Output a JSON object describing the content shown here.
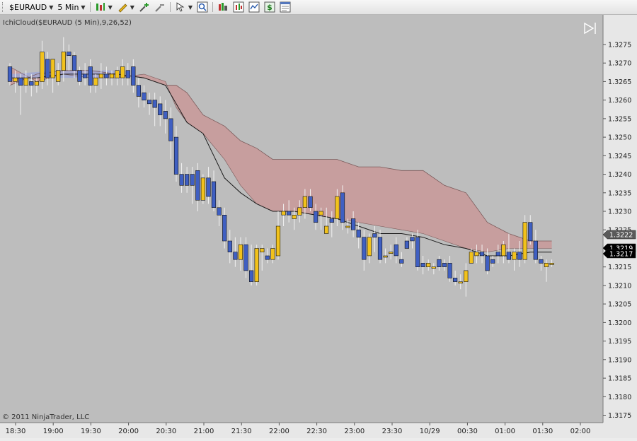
{
  "toolbar": {
    "instrument": "$EURAUD",
    "interval": "5 Min",
    "icons": [
      "bar-style-icon",
      "drawing-tools-icon",
      "zoom-in-icon",
      "zoom-out-icon",
      "cursor-icon",
      "zoom-box-icon",
      "data-box-icon",
      "strategy-icon",
      "chart-trader-icon",
      "dollar-icon",
      "properties-icon"
    ]
  },
  "indicator_label": "IchiCloud($EURAUD (5 Min),9,26,52)",
  "copyright": "© 2011 NinjaTrader, LLC",
  "colors": {
    "background": "#bdbdbd",
    "up_candle": "#f2c21c",
    "down_candle": "#3f5fc2",
    "cloud_bear": "#c89a9a",
    "cloud_bull": "#9fa8d6",
    "kijun_line": "#1a1a1a",
    "price_box_dark": "#000000",
    "price_box_gray": "#5a5a5a"
  },
  "chart_data": {
    "type": "candlestick",
    "y_axis": {
      "min": 1.3173,
      "max": 1.3283,
      "ticks": [
        "1.3175",
        "1.3180",
        "1.3185",
        "1.3190",
        "1.3195",
        "1.3200",
        "1.3205",
        "1.3210",
        "1.3215",
        "1.3220",
        "1.3225",
        "1.3230",
        "1.3235",
        "1.3240",
        "1.3245",
        "1.3250",
        "1.3255",
        "1.3260",
        "1.3265",
        "1.3270",
        "1.3275"
      ]
    },
    "x_axis": {
      "labels": [
        "18:30",
        "19:00",
        "19:30",
        "20:00",
        "20:30",
        "21:00",
        "21:30",
        "22:00",
        "22:30",
        "23:00",
        "23:30",
        "10/29",
        "00:30",
        "01:00",
        "01:30",
        "02:00"
      ]
    },
    "price_markers": [
      {
        "value": "1.3222",
        "style": "gray"
      },
      {
        "value": "1.3219",
        "style": "dark"
      },
      {
        "value": "1.3217",
        "style": "dark"
      }
    ],
    "candles": [
      [
        1.3269,
        1.327,
        1.3264,
        1.3265
      ],
      [
        1.3265,
        1.3268,
        1.3262,
        1.3266
      ],
      [
        1.3266,
        1.3267,
        1.3256,
        1.3264
      ],
      [
        1.3264,
        1.3268,
        1.3262,
        1.3266
      ],
      [
        1.3265,
        1.3267,
        1.3261,
        1.3264
      ],
      [
        1.3264,
        1.3266,
        1.3262,
        1.3265
      ],
      [
        1.3265,
        1.3276,
        1.3263,
        1.3273
      ],
      [
        1.3271,
        1.3273,
        1.3264,
        1.3266
      ],
      [
        1.3266,
        1.3271,
        1.3262,
        1.3271
      ],
      [
        1.3265,
        1.327,
        1.3264,
        1.3268
      ],
      [
        1.3268,
        1.3277,
        1.3265,
        1.3273
      ],
      [
        1.3273,
        1.3275,
        1.3268,
        1.3272
      ],
      [
        1.3272,
        1.3273,
        1.3266,
        1.3268
      ],
      [
        1.3268,
        1.3269,
        1.3264,
        1.3265
      ],
      [
        1.3267,
        1.327,
        1.3264,
        1.3266
      ],
      [
        1.3269,
        1.3271,
        1.3262,
        1.3264
      ],
      [
        1.3264,
        1.3267,
        1.3262,
        1.3266
      ],
      [
        1.3266,
        1.327,
        1.3263,
        1.3267
      ],
      [
        1.3267,
        1.3269,
        1.3264,
        1.3266
      ],
      [
        1.3266,
        1.3268,
        1.3264,
        1.3267
      ],
      [
        1.3266,
        1.3269,
        1.3264,
        1.3268
      ],
      [
        1.3266,
        1.3271,
        1.3264,
        1.3269
      ],
      [
        1.3268,
        1.327,
        1.3264,
        1.3266
      ],
      [
        1.3269,
        1.3271,
        1.3262,
        1.3264
      ],
      [
        1.3264,
        1.3266,
        1.3258,
        1.3261
      ],
      [
        1.3262,
        1.3264,
        1.3258,
        1.326
      ],
      [
        1.326,
        1.3262,
        1.3256,
        1.3259
      ],
      [
        1.326,
        1.3262,
        1.3253,
        1.3258
      ],
      [
        1.3259,
        1.3261,
        1.3253,
        1.3256
      ],
      [
        1.3257,
        1.326,
        1.3251,
        1.3255
      ],
      [
        1.3255,
        1.3258,
        1.3244,
        1.3249
      ],
      [
        1.325,
        1.3253,
        1.3238,
        1.324
      ],
      [
        1.324,
        1.3243,
        1.3235,
        1.3237
      ],
      [
        1.324,
        1.3242,
        1.3235,
        1.3237
      ],
      [
        1.324,
        1.3242,
        1.3232,
        1.3237
      ],
      [
        1.3241,
        1.3243,
        1.323,
        1.3233
      ],
      [
        1.3233,
        1.324,
        1.3232,
        1.3239
      ],
      [
        1.3239,
        1.3242,
        1.3232,
        1.3234
      ],
      [
        1.3238,
        1.3241,
        1.323,
        1.3231
      ],
      [
        1.3231,
        1.3233,
        1.3226,
        1.3229
      ],
      [
        1.3229,
        1.3231,
        1.322,
        1.3222
      ],
      [
        1.3222,
        1.3225,
        1.3216,
        1.3219
      ],
      [
        1.3219,
        1.3223,
        1.3215,
        1.3217
      ],
      [
        1.3217,
        1.3223,
        1.3214,
        1.3221
      ],
      [
        1.3221,
        1.3223,
        1.3212,
        1.3214
      ],
      [
        1.3214,
        1.3221,
        1.321,
        1.3211
      ],
      [
        1.3211,
        1.3221,
        1.321,
        1.322
      ],
      [
        1.3219,
        1.3221,
        1.3214,
        1.322
      ],
      [
        1.3218,
        1.322,
        1.3216,
        1.3217
      ],
      [
        1.3217,
        1.3221,
        1.3216,
        1.322
      ],
      [
        1.3218,
        1.323,
        1.3217,
        1.3226
      ],
      [
        1.3229,
        1.3232,
        1.3226,
        1.323
      ],
      [
        1.323,
        1.3233,
        1.3227,
        1.3229
      ],
      [
        1.3228,
        1.3231,
        1.3225,
        1.3229
      ],
      [
        1.3229,
        1.3233,
        1.3227,
        1.3231
      ],
      [
        1.3231,
        1.3236,
        1.3228,
        1.3234
      ],
      [
        1.3234,
        1.3236,
        1.323,
        1.3231
      ],
      [
        1.323,
        1.3232,
        1.3225,
        1.3227
      ],
      [
        1.3229,
        1.3231,
        1.3225,
        1.323
      ],
      [
        1.3224,
        1.3231,
        1.3224,
        1.3226
      ],
      [
        1.3228,
        1.323,
        1.3223,
        1.3227
      ],
      [
        1.3228,
        1.3236,
        1.3226,
        1.3234
      ],
      [
        1.3235,
        1.3237,
        1.3225,
        1.3227
      ],
      [
        1.3226,
        1.3228,
        1.3224,
        1.3226
      ],
      [
        1.3228,
        1.323,
        1.3223,
        1.3225
      ],
      [
        1.3225,
        1.3227,
        1.322,
        1.3223
      ],
      [
        1.3223,
        1.3225,
        1.3214,
        1.3217
      ],
      [
        1.3218,
        1.3224,
        1.3216,
        1.3223
      ],
      [
        1.3224,
        1.3226,
        1.3219,
        1.3223
      ],
      [
        1.3223,
        1.3225,
        1.3216,
        1.3217
      ],
      [
        1.3218,
        1.322,
        1.3216,
        1.3218
      ],
      [
        1.3219,
        1.3221,
        1.3217,
        1.3219
      ],
      [
        1.3221,
        1.3223,
        1.3216,
        1.3218
      ],
      [
        1.3217,
        1.3219,
        1.3215,
        1.3216
      ],
      [
        1.3222,
        1.3223,
        1.322,
        1.322
      ],
      [
        1.3223,
        1.3224,
        1.322,
        1.3222
      ],
      [
        1.3223,
        1.3225,
        1.3214,
        1.3215
      ],
      [
        1.3216,
        1.3218,
        1.3213,
        1.3215
      ],
      [
        1.3215,
        1.3217,
        1.3214,
        1.3216
      ],
      [
        1.3215,
        1.3216,
        1.3213,
        1.3215
      ],
      [
        1.3217,
        1.3218,
        1.3214,
        1.3215
      ],
      [
        1.3216,
        1.3217,
        1.3214,
        1.3215
      ],
      [
        1.3216,
        1.3218,
        1.3211,
        1.3212
      ],
      [
        1.3212,
        1.3214,
        1.321,
        1.3211
      ],
      [
        1.3211,
        1.3213,
        1.3209,
        1.3211
      ],
      [
        1.3211,
        1.3216,
        1.3207,
        1.3214
      ],
      [
        1.3216,
        1.322,
        1.3216,
        1.3219
      ],
      [
        1.3218,
        1.3221,
        1.3216,
        1.3219
      ],
      [
        1.3219,
        1.3221,
        1.3216,
        1.3218
      ],
      [
        1.3218,
        1.322,
        1.3213,
        1.3214
      ],
      [
        1.3217,
        1.3218,
        1.3215,
        1.3216
      ],
      [
        1.3219,
        1.3221,
        1.3216,
        1.3218
      ],
      [
        1.3218,
        1.3222,
        1.3216,
        1.3221
      ],
      [
        1.3219,
        1.3224,
        1.3216,
        1.3217
      ],
      [
        1.3217,
        1.322,
        1.3214,
        1.3219
      ],
      [
        1.3219,
        1.3222,
        1.3215,
        1.3217
      ],
      [
        1.3217,
        1.3229,
        1.3216,
        1.3227
      ],
      [
        1.3227,
        1.3229,
        1.3221,
        1.3222
      ],
      [
        1.3222,
        1.3225,
        1.3216,
        1.3217
      ],
      [
        1.3217,
        1.3218,
        1.3214,
        1.3216
      ],
      [
        1.3215,
        1.3217,
        1.3211,
        1.3216
      ],
      [
        1.3216,
        1.3217,
        1.3215,
        1.3216
      ]
    ],
    "cloud": [
      {
        "i": 0,
        "a": 1.3269,
        "b": 1.3264
      },
      {
        "i": 5,
        "a": 1.3265,
        "b": 1.3267
      },
      {
        "i": 10,
        "a": 1.3267,
        "b": 1.3268
      },
      {
        "i": 15,
        "a": 1.3266,
        "b": 1.3268
      },
      {
        "i": 20,
        "a": 1.3266,
        "b": 1.3267
      },
      {
        "i": 25,
        "a": 1.3267,
        "b": 1.3266
      },
      {
        "i": 29,
        "a": 1.3265,
        "b": 1.3264
      },
      {
        "i": 31,
        "a": 1.3258,
        "b": 1.3264
      },
      {
        "i": 33,
        "a": 1.3254,
        "b": 1.3262
      },
      {
        "i": 36,
        "a": 1.3251,
        "b": 1.3256
      },
      {
        "i": 40,
        "a": 1.3244,
        "b": 1.3253
      },
      {
        "i": 43,
        "a": 1.3237,
        "b": 1.3249
      },
      {
        "i": 46,
        "a": 1.3232,
        "b": 1.3247
      },
      {
        "i": 49,
        "a": 1.323,
        "b": 1.3244
      },
      {
        "i": 53,
        "a": 1.323,
        "b": 1.3244
      },
      {
        "i": 57,
        "a": 1.3229,
        "b": 1.3244
      },
      {
        "i": 61,
        "a": 1.3228,
        "b": 1.3244
      },
      {
        "i": 65,
        "a": 1.3227,
        "b": 1.3242
      },
      {
        "i": 69,
        "a": 1.3226,
        "b": 1.3242
      },
      {
        "i": 73,
        "a": 1.3225,
        "b": 1.3241
      },
      {
        "i": 77,
        "a": 1.3224,
        "b": 1.3241
      },
      {
        "i": 81,
        "a": 1.3222,
        "b": 1.3237
      },
      {
        "i": 85,
        "a": 1.322,
        "b": 1.3235
      },
      {
        "i": 89,
        "a": 1.3219,
        "b": 1.3227
      },
      {
        "i": 93,
        "a": 1.322,
        "b": 1.3224
      },
      {
        "i": 97,
        "a": 1.322,
        "b": 1.3222
      },
      {
        "i": 101,
        "a": 1.322,
        "b": 1.3222
      }
    ],
    "kijun": [
      {
        "i": 0,
        "v": 1.3266
      },
      {
        "i": 5,
        "v": 1.3266
      },
      {
        "i": 10,
        "v": 1.3267
      },
      {
        "i": 15,
        "v": 1.3267
      },
      {
        "i": 20,
        "v": 1.3267
      },
      {
        "i": 25,
        "v": 1.3266
      },
      {
        "i": 29,
        "v": 1.3264
      },
      {
        "i": 31,
        "v": 1.3259
      },
      {
        "i": 33,
        "v": 1.3254
      },
      {
        "i": 36,
        "v": 1.3251
      },
      {
        "i": 40,
        "v": 1.3239
      },
      {
        "i": 43,
        "v": 1.3235
      },
      {
        "i": 46,
        "v": 1.3232
      },
      {
        "i": 49,
        "v": 1.323
      },
      {
        "i": 53,
        "v": 1.323
      },
      {
        "i": 57,
        "v": 1.3229
      },
      {
        "i": 61,
        "v": 1.3228
      },
      {
        "i": 65,
        "v": 1.3226
      },
      {
        "i": 69,
        "v": 1.3224
      },
      {
        "i": 73,
        "v": 1.3224
      },
      {
        "i": 77,
        "v": 1.3223
      },
      {
        "i": 81,
        "v": 1.3221
      },
      {
        "i": 85,
        "v": 1.322
      },
      {
        "i": 89,
        "v": 1.3218
      },
      {
        "i": 93,
        "v": 1.3218
      },
      {
        "i": 97,
        "v": 1.3219
      },
      {
        "i": 101,
        "v": 1.3219
      }
    ]
  }
}
